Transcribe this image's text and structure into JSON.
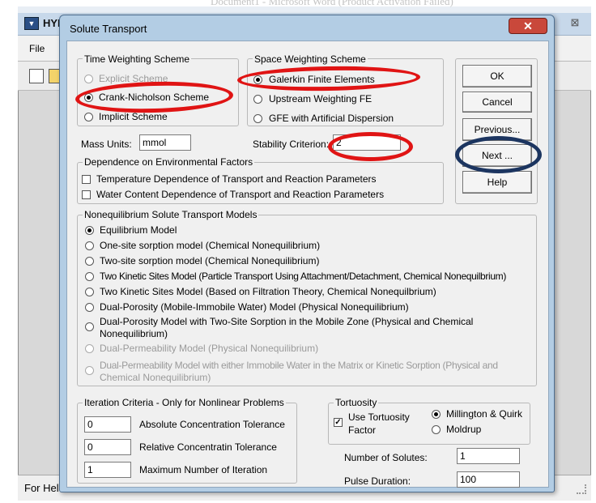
{
  "background_app": {
    "title": "HYD",
    "document_title": "Document1 - Microsoft Word (Product Activation Failed)",
    "menu_file": "File",
    "status_text": "For Hel",
    "close_glyph": "⊠"
  },
  "dialog": {
    "title": "Solute Transport",
    "close_glyph": "✕"
  },
  "time_weighting": {
    "legend": "Time Weighting Scheme",
    "options": [
      {
        "label": "Explicit Scheme",
        "selected": false,
        "enabled": false
      },
      {
        "label": "Crank-Nicholson Scheme",
        "selected": true,
        "enabled": true
      },
      {
        "label": "Implicit Scheme",
        "selected": false,
        "enabled": true
      }
    ]
  },
  "space_weighting": {
    "legend": "Space Weighting Scheme",
    "options": [
      {
        "label": "Galerkin Finite Elements",
        "selected": true,
        "enabled": true
      },
      {
        "label": "Upstream Weighting FE",
        "selected": false,
        "enabled": true
      },
      {
        "label": "GFE with Artificial Dispersion",
        "selected": false,
        "enabled": true
      }
    ]
  },
  "buttons": {
    "ok": "OK",
    "cancel": "Cancel",
    "previous": "Previous...",
    "next": "Next ...",
    "help": "Help"
  },
  "mass_units": {
    "label": "Mass Units:",
    "value": "mmol"
  },
  "stability": {
    "label": "Stability Criterion:",
    "value": "2"
  },
  "environment": {
    "legend": "Dependence on Environmental Factors",
    "options": [
      {
        "label": "Temperature Dependence of Transport and Reaction Parameters",
        "checked": false
      },
      {
        "label": "Water Content Dependence of Transport and Reaction Parameters",
        "checked": false
      }
    ]
  },
  "nonequilibrium": {
    "legend": "Nonequilibrium Solute Transport Models",
    "options": [
      {
        "label": "Equilibrium Model",
        "selected": true,
        "enabled": true
      },
      {
        "label": "One-site sorption model (Chemical Nonequilibrium)",
        "selected": false,
        "enabled": true
      },
      {
        "label": "Two-site sorption model (Chemical Nonequilibrium)",
        "selected": false,
        "enabled": true
      },
      {
        "label": "Two Kinetic Sites Model (Particle Transport Using Attachment/Detachment, Chemical Nonequilbrium)",
        "selected": false,
        "enabled": true
      },
      {
        "label": "Two Kinetic Sites Model (Based on Filtration Theory, Chemical Nonequilbrium)",
        "selected": false,
        "enabled": true
      },
      {
        "label": "Dual-Porosity (Mobile-Immobile Water) Model (Physical Nonequilibrium)",
        "selected": false,
        "enabled": true
      },
      {
        "label": "Dual-Porosity Model with Two-Site Sorption in the Mobile Zone (Physical and Chemical",
        "label2": "Nonequilibrium)",
        "selected": false,
        "enabled": true
      },
      {
        "label": "Dual-Permeability Model (Physical Nonequilibrium)",
        "selected": false,
        "enabled": false
      },
      {
        "label": "Dual-Permeability Model with either Immobile Water in the Matrix or Kinetic Sorption (Physical and",
        "label2": "Chemical Nonequilibrium)",
        "selected": false,
        "enabled": false
      }
    ]
  },
  "iteration": {
    "legend": "Iteration Criteria - Only for Nonlinear Problems",
    "rows": [
      {
        "value": "0",
        "label": "Absolute Concentration Tolerance"
      },
      {
        "value": "0",
        "label": "Relative Concentratin Tolerance"
      },
      {
        "value": "1",
        "label": "Maximum Number of Iteration"
      }
    ]
  },
  "tortuosity": {
    "legend": "Tortuosity",
    "use_label_1": "Use Tortuosity",
    "use_label_2": "Factor",
    "use_checked": true,
    "options": [
      {
        "label": "Millington & Quirk",
        "selected": true
      },
      {
        "label": "Moldrup",
        "selected": false
      }
    ]
  },
  "solutes": {
    "label": "Number of Solutes:",
    "value": "1"
  },
  "pulse": {
    "label": "Pulse Duration:",
    "value": "100"
  },
  "colors": {
    "annotation_red": "#e01414",
    "annotation_navy": "#1c3560",
    "dialog_frame": "#b3cde4",
    "close_button": "#c9483b"
  }
}
